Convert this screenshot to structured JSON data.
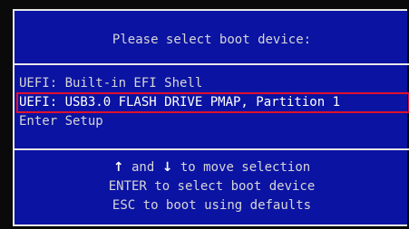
{
  "dialog": {
    "title": "Please select boot device:",
    "colors": {
      "background": "#0b13a2",
      "text": "#d6d6d6",
      "border": "#e8e8e8",
      "highlight_outline": "#e0102a"
    }
  },
  "menu": {
    "items": [
      {
        "label": "UEFI: Built-in EFI Shell",
        "selected": false
      },
      {
        "label": "UEFI: USB3.0 FLASH DRIVE PMAP, Partition 1",
        "selected": true
      },
      {
        "label": "Enter Setup",
        "selected": false
      }
    ]
  },
  "help": {
    "line1_up_arrow": "↑",
    "line1_and": " and ",
    "line1_down_arrow": "↓",
    "line1_rest": " to move selection",
    "line2": "ENTER to select boot device",
    "line3": "ESC to boot using defaults"
  }
}
